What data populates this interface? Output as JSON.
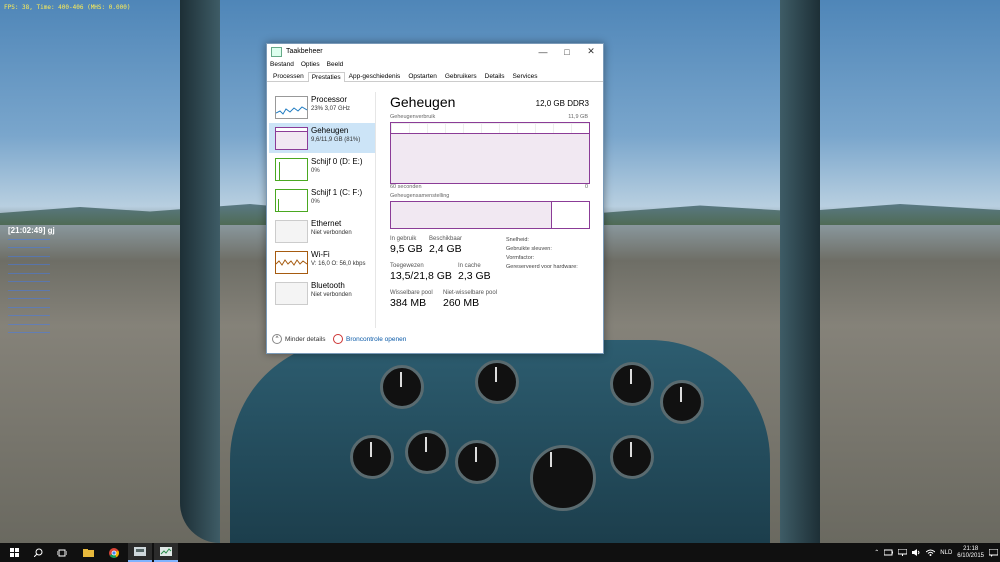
{
  "background": {
    "hud_text": "FPS:   38,  Time: 400-406 (MHS: 0.000)",
    "chat_time": "[21:02:49] gj",
    "chat_lines": [
      "———————",
      "———————",
      "———————",
      "———————",
      "———————",
      "———————",
      "———————",
      "———————",
      "———————",
      "———————",
      "———————",
      "———————"
    ]
  },
  "window": {
    "title": "Taakbeheer",
    "menu": [
      "Bestand",
      "Opties",
      "Beeld"
    ],
    "tabs": [
      "Processen",
      "Prestaties",
      "App-geschiedenis",
      "Opstarten",
      "Gebruikers",
      "Details",
      "Services"
    ],
    "active_tab": 1
  },
  "sidebar": [
    {
      "title": "Processor",
      "subtitle": "23%  3,07 GHz",
      "color": "#1f7bc1"
    },
    {
      "title": "Geheugen",
      "subtitle": "9,6/11,9 GB (81%)",
      "color": "#8b3c97"
    },
    {
      "title": "Schijf 0 (D: E:)",
      "subtitle": "0%",
      "color": "#4aa821"
    },
    {
      "title": "Schijf 1 (C: F:)",
      "subtitle": "0%",
      "color": "#4aa821"
    },
    {
      "title": "Ethernet",
      "subtitle": "Niet verbonden",
      "color": "#a65b10"
    },
    {
      "title": "Wi-Fi",
      "subtitle": "V: 16,0  O: 56,0 kbps",
      "color": "#a65b10"
    },
    {
      "title": "Bluetooth",
      "subtitle": "Niet verbonden",
      "color": "#a65b10"
    }
  ],
  "main": {
    "title": "Geheugen",
    "spec": "12,0 GB DDR3",
    "usage_label": "Geheugenverbruik",
    "usage_max": "11,9 GB",
    "axis_left": "60 seconden",
    "axis_right": "0",
    "usage_fraction": 0.81,
    "composition_label": "Geheugensamenstelling",
    "composition_used_fraction": 0.81,
    "stats": {
      "in_use_label": "In gebruik",
      "in_use": "9,5 GB",
      "available_label": "Beschikbaar",
      "available": "2,4 GB",
      "committed_label": "Toegewezen",
      "committed": "13,5/21,8 GB",
      "cached_label": "In cache",
      "cached": "2,3 GB",
      "paged_label": "Wisselbare pool",
      "paged": "384 MB",
      "nonpaged_label": "Niet-wisselbare pool",
      "nonpaged": "260 MB",
      "speed_label": "Snelheid:",
      "slots_label": "Gebruikte sleuven:",
      "form_label": "Vormfactor:",
      "reserved_label": "Gereserveerd voor hardware:"
    }
  },
  "footer": {
    "less_details": "Minder details",
    "open_monitor": "Broncontrole openen"
  },
  "taskbar": {
    "language": "NLD",
    "time": "21:18",
    "date": "6/10/2015"
  }
}
